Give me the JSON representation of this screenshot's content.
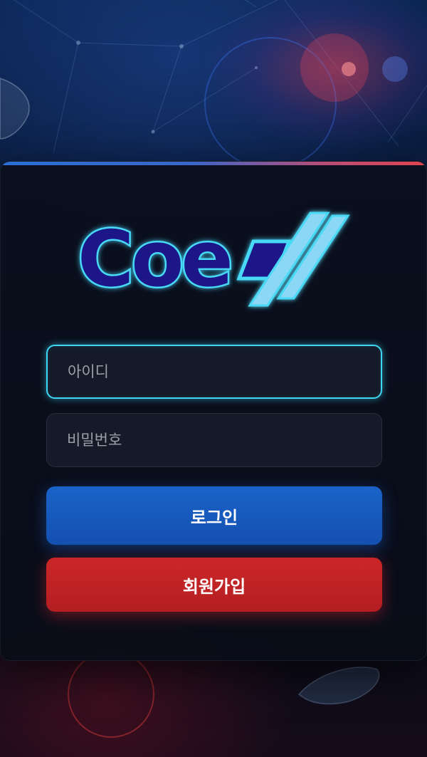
{
  "login": {
    "username_placeholder": "아이디",
    "password_placeholder": "비밀번호",
    "login_label": "로그인",
    "signup_label": "회원가입"
  },
  "colors": {
    "accent_cyan": "#3ed6f2",
    "login_button": "#1a5fc4",
    "signup_button": "#c52426",
    "logo_fill": "#1b1488",
    "logo_glow": "#46d9f5"
  },
  "icons": [
    "coex-logo"
  ]
}
